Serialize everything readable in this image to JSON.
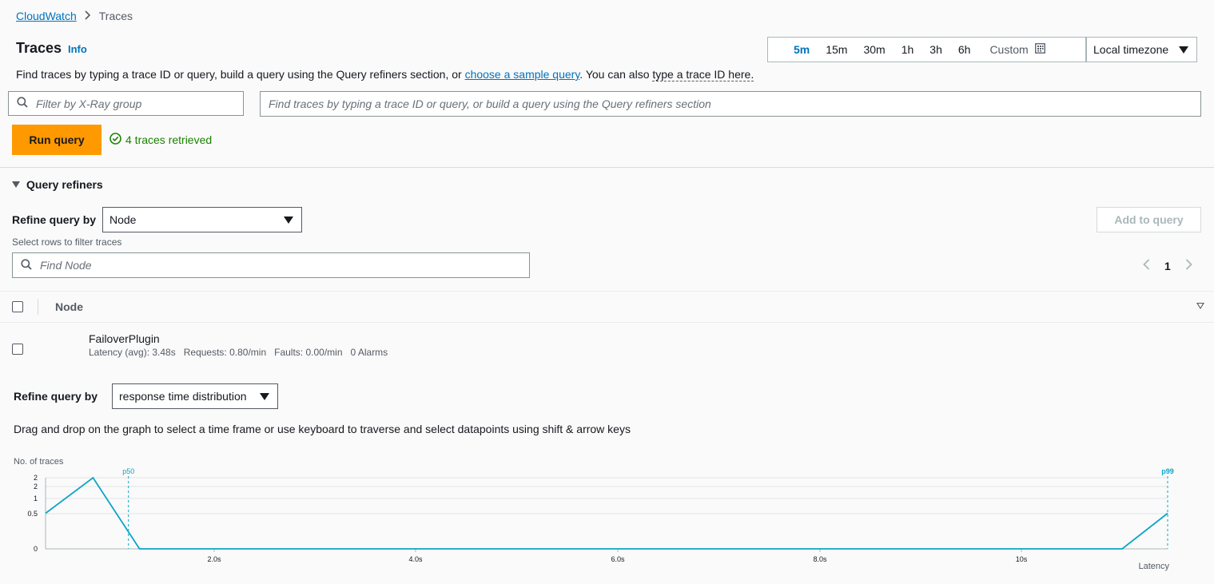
{
  "breadcrumb": {
    "root": "CloudWatch",
    "current": "Traces"
  },
  "title": "Traces",
  "info": "Info",
  "time_range": {
    "options": [
      "5m",
      "15m",
      "30m",
      "1h",
      "3h",
      "6h"
    ],
    "selected": "5m",
    "custom_label": "Custom",
    "timezone": "Local timezone"
  },
  "description": {
    "prefix": "Find traces by typing a trace ID or query, build a query using the Query refiners section, or ",
    "link": "choose a sample query",
    "middle": ". You can also ",
    "dotted": "type a trace ID here."
  },
  "group_filter": {
    "placeholder": "Filter by X-Ray group"
  },
  "query_input": {
    "placeholder": "Find traces by typing a trace ID or query, or build a query using the Query refiners section"
  },
  "run_query": "Run query",
  "status": "4 traces retrieved",
  "refiners": {
    "toggle_label": "Query refiners",
    "refine_label": "Refine query by",
    "refine_value": "Node",
    "add_to_query": "Add to query",
    "select_rows_hint": "Select rows to filter traces",
    "find_placeholder": "Find Node",
    "page": "1"
  },
  "table": {
    "column": "Node",
    "rows": [
      {
        "name": "FailoverPlugin",
        "latency": "Latency (avg): 3.48s",
        "requests": "Requests: 0.80/min",
        "faults": "Faults: 0.00/min",
        "alarms": "0 Alarms"
      }
    ]
  },
  "distribution": {
    "refine_label": "Refine query by",
    "refine_value": "response time distribution",
    "hint": "Drag and drop on the graph to select a time frame or use keyboard to traverse and select datapoints using shift & arrow keys"
  },
  "colors": {
    "accent": "#0073bb",
    "primary_button": "#ff9900",
    "success": "#1d8102",
    "series": "#0ca5c4"
  },
  "chart_data": {
    "type": "line",
    "ylabel": "No. of traces",
    "xlabel": "Latency",
    "y_ticks": [
      "0",
      "0.5",
      "1",
      "2",
      "2"
    ],
    "x_ticks": [
      "2.0s",
      "4.0s",
      "6.0s",
      "8.0s",
      "10s"
    ],
    "xlim": [
      0,
      11.1
    ],
    "ylim": [
      0,
      2
    ],
    "series": [
      {
        "x": [
          0,
          0.47,
          0.93,
          10.65,
          11.1
        ],
        "y": [
          1,
          2,
          0,
          0,
          1
        ]
      }
    ],
    "markers": [
      {
        "label": "p50",
        "x": 0.82
      },
      {
        "label": "p99",
        "x": 11.1
      }
    ]
  }
}
